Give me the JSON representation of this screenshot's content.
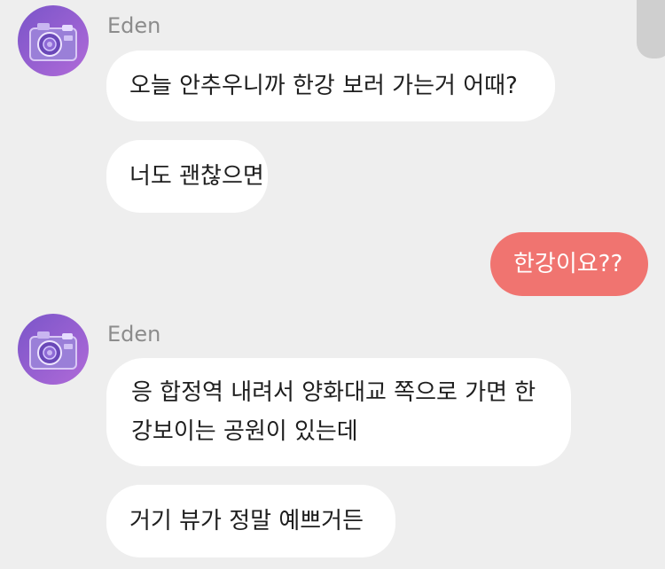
{
  "messages": [
    {
      "sender": "Eden",
      "bubbles": [
        "오늘 안추우니까 한강 보러 가는거 어때?",
        "너도 괜찮으면"
      ]
    },
    {
      "mine": true,
      "text": "한강이요??"
    },
    {
      "sender": "Eden",
      "bubbles": [
        "응 합정역 내려서 양화대교 쪽으로 가면 한강보이는 공원이 있는데",
        "거기 뷰가 정말 예쁘거든"
      ]
    }
  ],
  "colors": {
    "background": "#eeeeee",
    "incoming_bubble": "#ffffff",
    "outgoing_bubble": "#f07470",
    "sender_name": "#8c8c8c"
  },
  "icons": {
    "avatar": "camera-avatar-icon"
  }
}
